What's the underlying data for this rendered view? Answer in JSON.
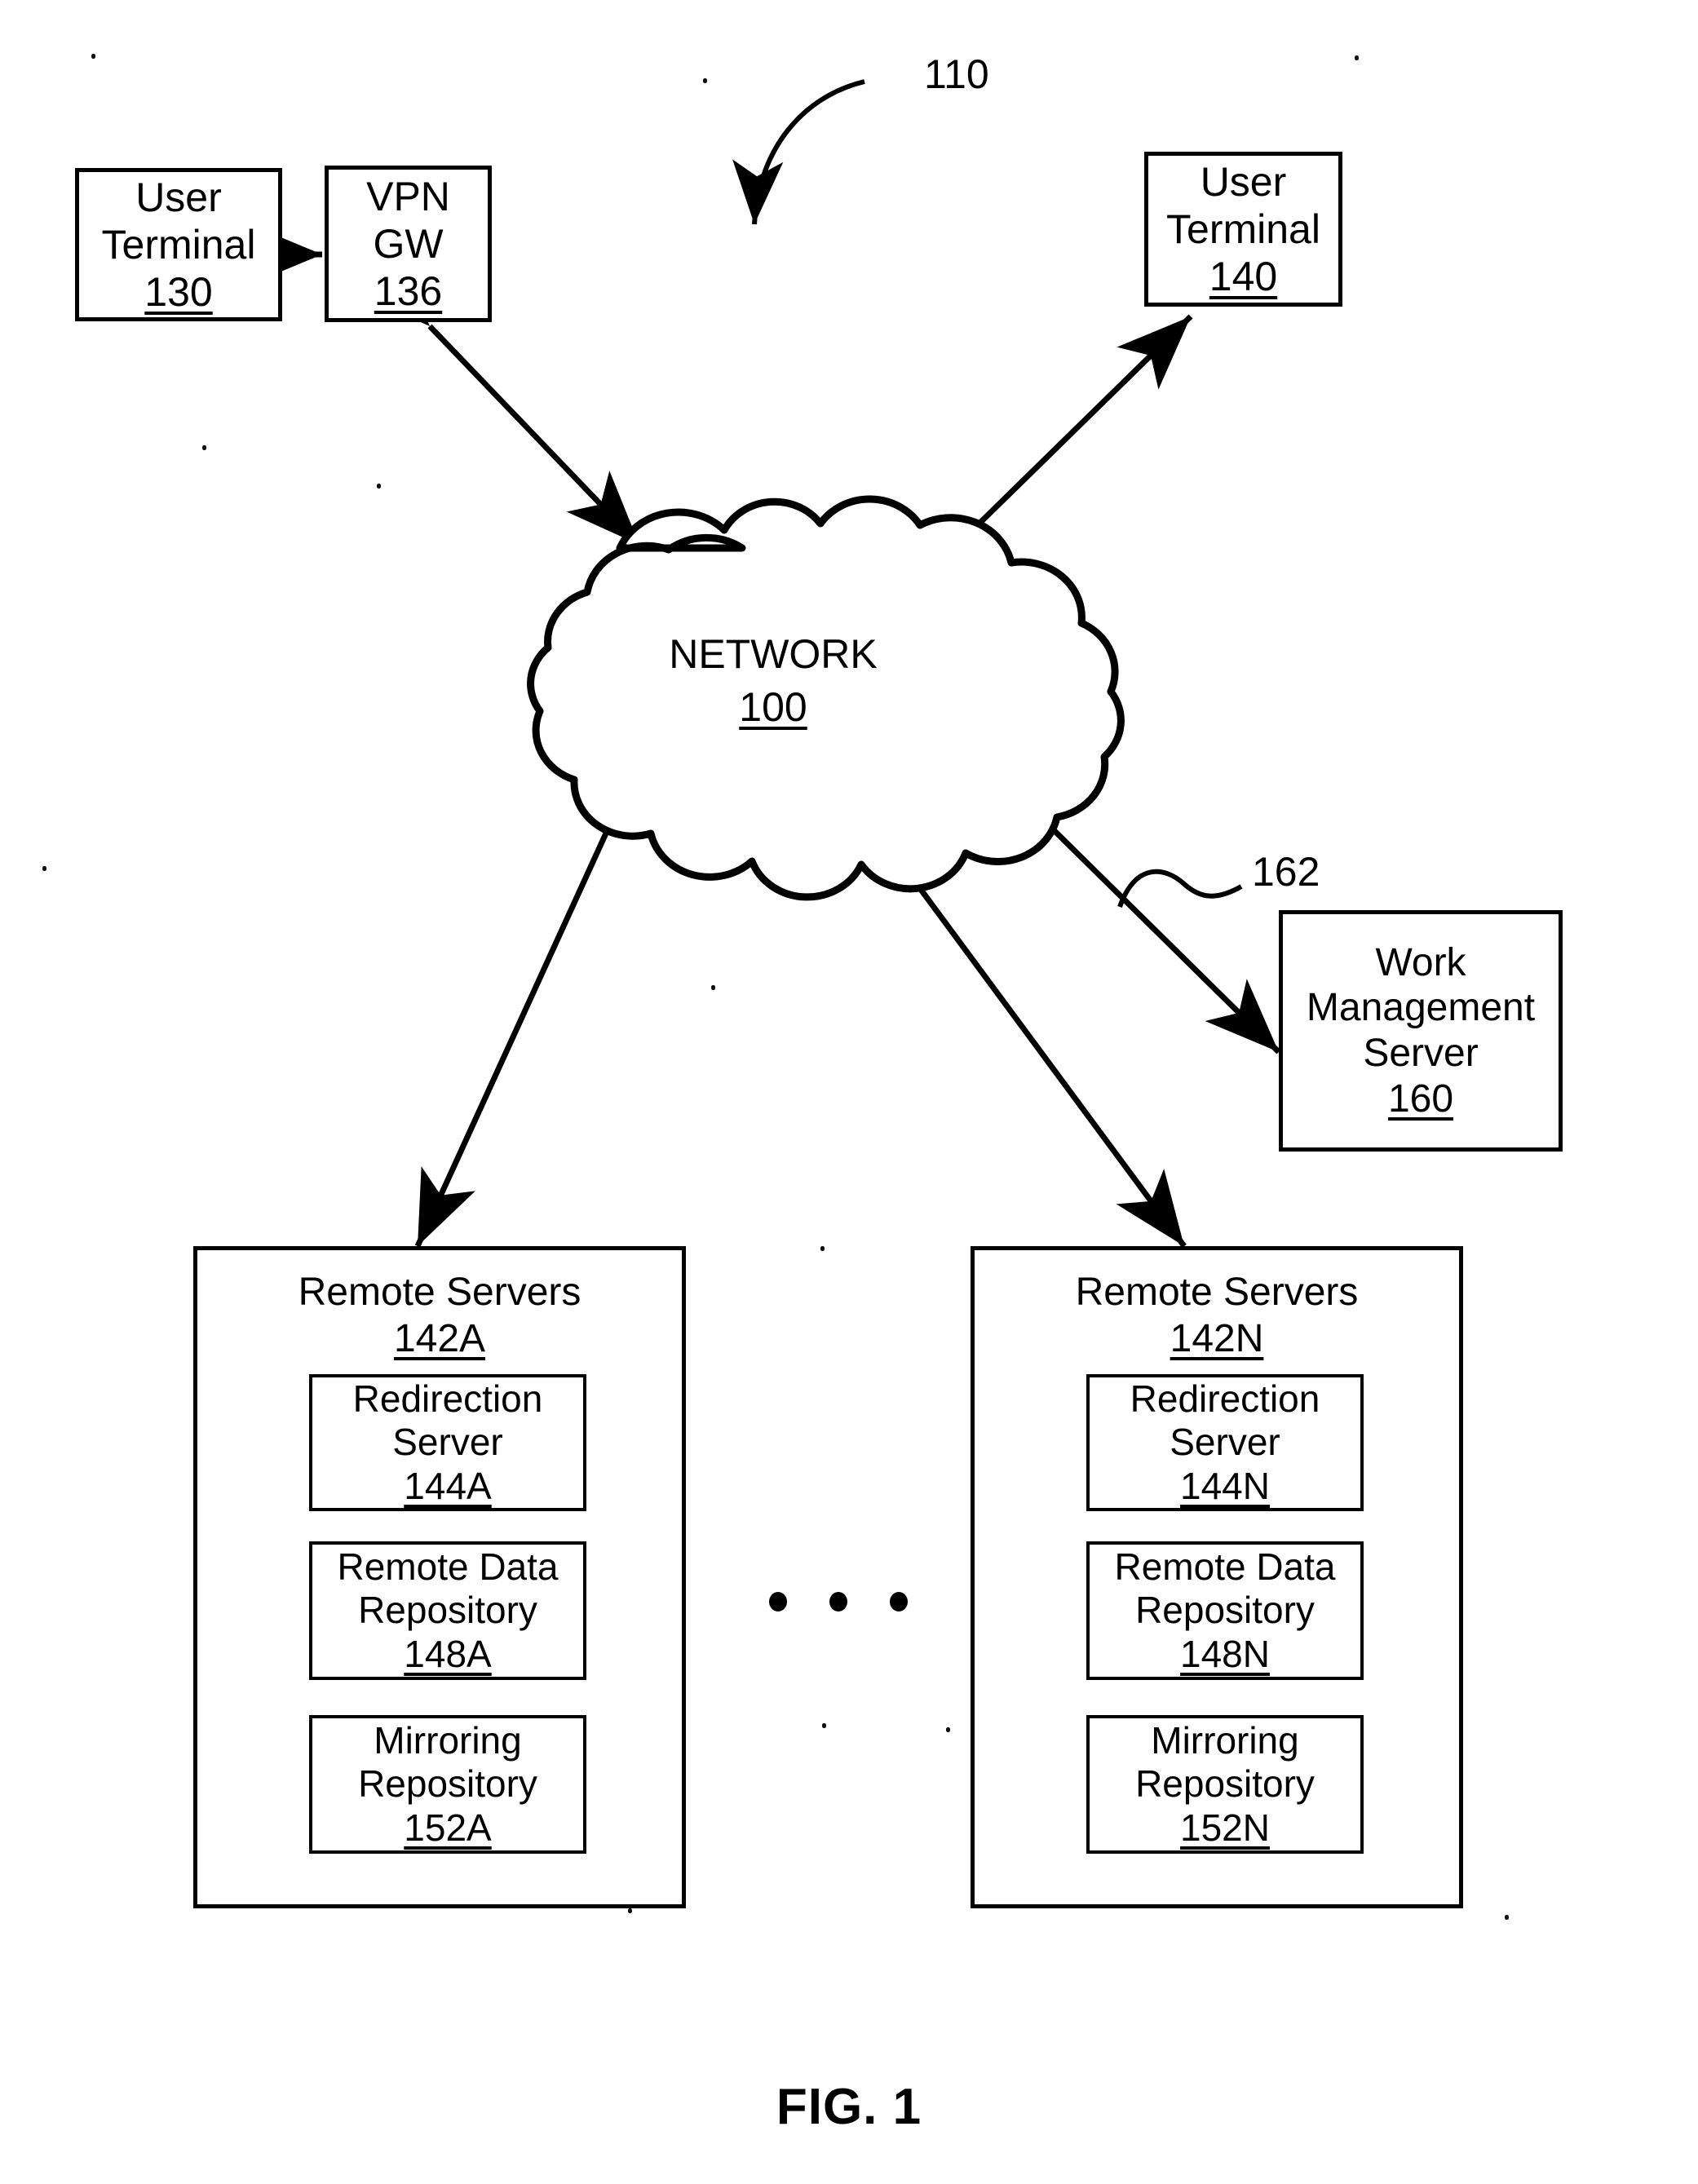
{
  "figure": {
    "caption": "FIG. 1",
    "system_ref": "110",
    "connector_ref": "162"
  },
  "nodes": {
    "user_terminal_130": {
      "line1": "User",
      "line2": "Terminal",
      "ref": "130"
    },
    "vpn_gw_136": {
      "line1": "VPN",
      "line2": "GW",
      "ref": "136"
    },
    "user_terminal_140": {
      "line1": "User",
      "line2": "Terminal",
      "ref": "140"
    },
    "network_100": {
      "label": "NETWORK",
      "ref": "100"
    },
    "work_management_server_160": {
      "line1": "Work",
      "line2": "Management",
      "line3": "Server",
      "ref": "160"
    }
  },
  "remote_server_groups": [
    {
      "title": "Remote Servers",
      "ref": "142A",
      "components": [
        {
          "line1": "Redirection",
          "line2": "Server",
          "ref": "144A"
        },
        {
          "line1": "Remote Data",
          "line2": "Repository",
          "ref": "148A"
        },
        {
          "line1": "Mirroring",
          "line2": "Repository",
          "ref": "152A"
        }
      ]
    },
    {
      "title": "Remote Servers",
      "ref": "142N",
      "components": [
        {
          "line1": "Redirection",
          "line2": "Server",
          "ref": "144N"
        },
        {
          "line1": "Remote Data",
          "line2": "Repository",
          "ref": "148N"
        },
        {
          "line1": "Mirroring",
          "line2": "Repository",
          "ref": "152N"
        }
      ]
    }
  ],
  "ellipsis": {
    "count": 3
  },
  "colors": {
    "ink": "#000000",
    "paper": "#ffffff"
  }
}
